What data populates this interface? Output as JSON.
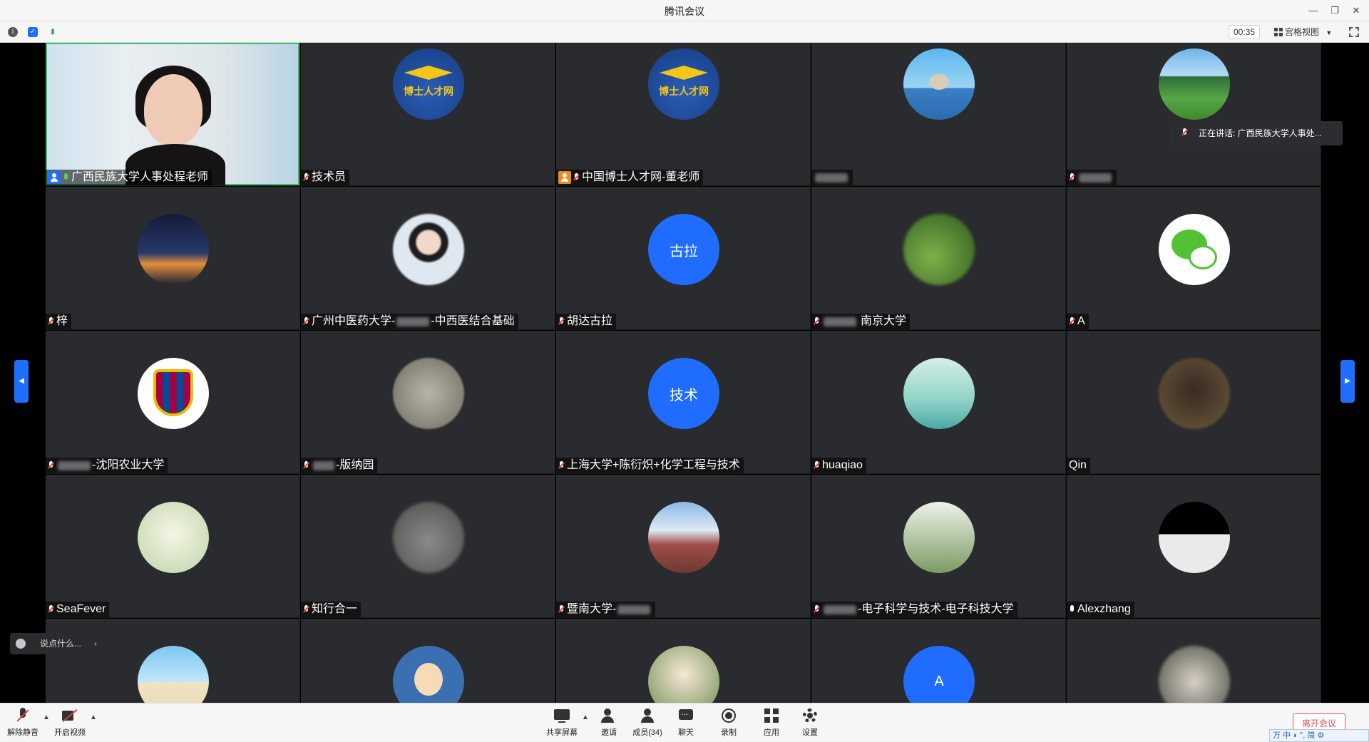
{
  "window": {
    "title": "腾讯会议"
  },
  "infobar": {
    "timer": "00:35",
    "view_label": "宫格视图"
  },
  "speaking": {
    "text": "正在讲话: 广西民族大学人事处..."
  },
  "participants": [
    {
      "name": "广西民族大学人事处程老师",
      "avatar": "self-video"
    },
    {
      "name": "技术员",
      "avatar": "cap",
      "avatar_text": "博士人才网"
    },
    {
      "name": "中国博士人才网-董老师",
      "avatar": "cap",
      "avatar_text": "博士人才网"
    },
    {
      "name": "",
      "avatar": "stone"
    },
    {
      "name": "",
      "avatar": "lake"
    },
    {
      "name": "梓",
      "avatar": "night"
    },
    {
      "name": "广州中医药大学-",
      "name_suffix": "-中西医结合基础",
      "avatar": "woman"
    },
    {
      "name": "胡达古拉",
      "avatar": "blue",
      "avatar_text": "古拉"
    },
    {
      "name": "南京大学",
      "avatar": "green"
    },
    {
      "name": "A",
      "avatar": "wechat"
    },
    {
      "name": "-沈阳农业大学",
      "avatar": "barca"
    },
    {
      "name": "-版纳园",
      "avatar": "ghost"
    },
    {
      "name": "上海大学+陈衍炽+化学工程与技术",
      "avatar": "blue",
      "avatar_text": "技术"
    },
    {
      "name": "huaqiao",
      "avatar": "boat"
    },
    {
      "name": "Qin",
      "avatar": "man"
    },
    {
      "name": "SeaFever",
      "avatar": "flowers"
    },
    {
      "name": "知行合一",
      "avatar": "blurgray"
    },
    {
      "name": "暨南大学-",
      "avatar": "red"
    },
    {
      "name": "-电子科学与技术-电子科技大学",
      "avatar": "man2"
    },
    {
      "name": "Alexzhang",
      "avatar": "hair"
    },
    {
      "name": "",
      "avatar": "beach"
    },
    {
      "name": "",
      "avatar": "cartoon"
    },
    {
      "name": "",
      "avatar": "blond"
    },
    {
      "name": "",
      "avatar": "blue",
      "avatar_text": "A"
    },
    {
      "name": "",
      "avatar": "blur2"
    }
  ],
  "chat": {
    "placeholder": "说点什么..."
  },
  "toolbar": {
    "unmute": "解除静音",
    "start_video": "开启视频",
    "share_screen": "共享屏幕",
    "invite": "邀请",
    "members": "成员(34)",
    "chat": "聊天",
    "record": "录制",
    "apps": "应用",
    "settings": "设置",
    "leave": "离开会议",
    "ime": "万 中 ◗ °, 简 ⚙"
  },
  "colors": {
    "accent": "#1e6fff",
    "speaking_green": "#33c16b",
    "leave_red": "#e34d4d"
  }
}
